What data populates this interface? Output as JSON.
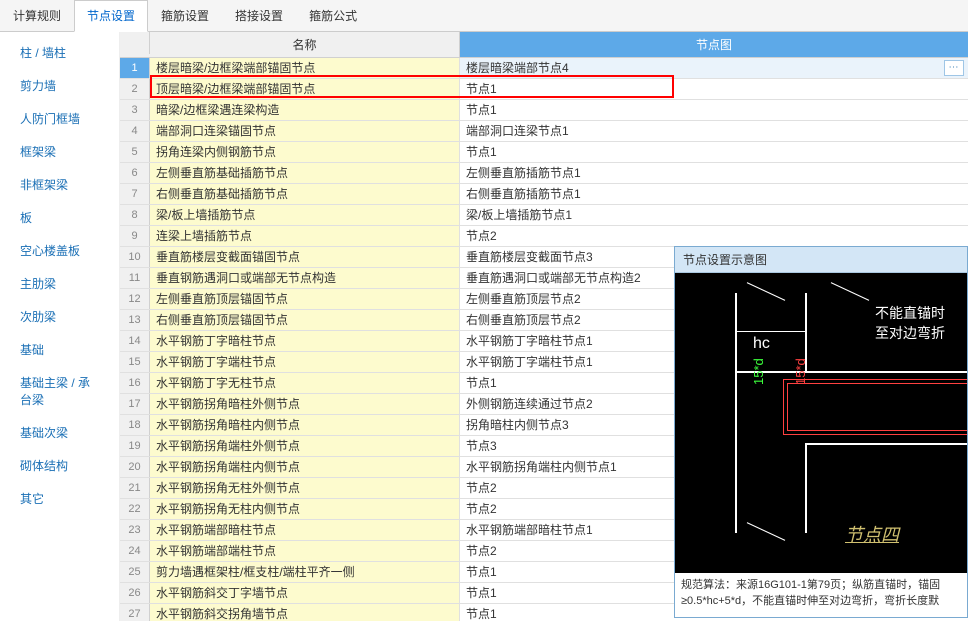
{
  "tabs": [
    "计算规则",
    "节点设置",
    "箍筋设置",
    "搭接设置",
    "箍筋公式"
  ],
  "activeTab": 1,
  "sidebar": {
    "items": [
      "柱 / 墙柱",
      "剪力墙",
      "人防门框墙",
      "框架梁",
      "非框架梁",
      "板",
      "空心楼盖板",
      "主肋梁",
      "次肋梁",
      "基础",
      "基础主梁 / 承台梁",
      "基础次梁",
      "砌体结构",
      "其它"
    ],
    "selected": 1
  },
  "table": {
    "headers": {
      "name": "名称",
      "node": "节点图"
    },
    "rows": [
      {
        "n": 1,
        "name": "楼层暗梁/边框梁端部锚固节点",
        "node": "楼层暗梁端部节点4"
      },
      {
        "n": 2,
        "name": "顶层暗梁/边框梁端部锚固节点",
        "node": "节点1"
      },
      {
        "n": 3,
        "name": "暗梁/边框梁遇连梁构造",
        "node": "节点1"
      },
      {
        "n": 4,
        "name": "端部洞口连梁锚固节点",
        "node": "端部洞口连梁节点1"
      },
      {
        "n": 5,
        "name": "拐角连梁内侧钢筋节点",
        "node": "节点1"
      },
      {
        "n": 6,
        "name": "左侧垂直筋基础插筋节点",
        "node": "左侧垂直筋插筋节点1"
      },
      {
        "n": 7,
        "name": "右侧垂直筋基础插筋节点",
        "node": "右侧垂直筋插筋节点1"
      },
      {
        "n": 8,
        "name": "梁/板上墙插筋节点",
        "node": "梁/板上墙插筋节点1"
      },
      {
        "n": 9,
        "name": "连梁上墙插筋节点",
        "node": "节点2"
      },
      {
        "n": 10,
        "name": "垂直筋楼层变截面锚固节点",
        "node": "垂直筋楼层变截面节点3"
      },
      {
        "n": 11,
        "name": "垂直钢筋遇洞口或端部无节点构造",
        "node": "垂直筋遇洞口或端部无节点构造2"
      },
      {
        "n": 12,
        "name": "左侧垂直筋顶层锚固节点",
        "node": "左侧垂直筋顶层节点2"
      },
      {
        "n": 13,
        "name": "右侧垂直筋顶层锚固节点",
        "node": "右侧垂直筋顶层节点2"
      },
      {
        "n": 14,
        "name": "水平钢筋丁字暗柱节点",
        "node": "水平钢筋丁字暗柱节点1"
      },
      {
        "n": 15,
        "name": "水平钢筋丁字端柱节点",
        "node": "水平钢筋丁字端柱节点1"
      },
      {
        "n": 16,
        "name": "水平钢筋丁字无柱节点",
        "node": "节点1"
      },
      {
        "n": 17,
        "name": "水平钢筋拐角暗柱外侧节点",
        "node": "外侧钢筋连续通过节点2"
      },
      {
        "n": 18,
        "name": "水平钢筋拐角暗柱内侧节点",
        "node": "拐角暗柱内侧节点3"
      },
      {
        "n": 19,
        "name": "水平钢筋拐角端柱外侧节点",
        "node": "节点3"
      },
      {
        "n": 20,
        "name": "水平钢筋拐角端柱内侧节点",
        "node": "水平钢筋拐角端柱内侧节点1"
      },
      {
        "n": 21,
        "name": "水平钢筋拐角无柱外侧节点",
        "node": "节点2"
      },
      {
        "n": 22,
        "name": "水平钢筋拐角无柱内侧节点",
        "node": "节点2"
      },
      {
        "n": 23,
        "name": "水平钢筋端部暗柱节点",
        "node": "水平钢筋端部暗柱节点1"
      },
      {
        "n": 24,
        "name": "水平钢筋端部端柱节点",
        "node": "节点2"
      },
      {
        "n": 25,
        "name": "剪力墙遇框架柱/框支柱/端柱平齐一侧",
        "node": "节点1"
      },
      {
        "n": 26,
        "name": "水平钢筋斜交丁字墙节点",
        "node": "节点1"
      },
      {
        "n": 27,
        "name": "水平钢筋斜交拐角墙节点",
        "node": "节点1"
      }
    ],
    "selectedRow": 0,
    "highlightRow": 1
  },
  "preview": {
    "title": "节点设置示意图",
    "hc": "hc",
    "dim1": "15*d",
    "dim2": "15*d",
    "note1": "不能直锚时",
    "note2": "至对边弯折",
    "label": "节点四",
    "footer": "规范算法：来源16G101-1第79页；纵筋直锚时，锚固≥0.5*hc+5*d，不能直锚时伸至对边弯折，弯折长度默"
  }
}
